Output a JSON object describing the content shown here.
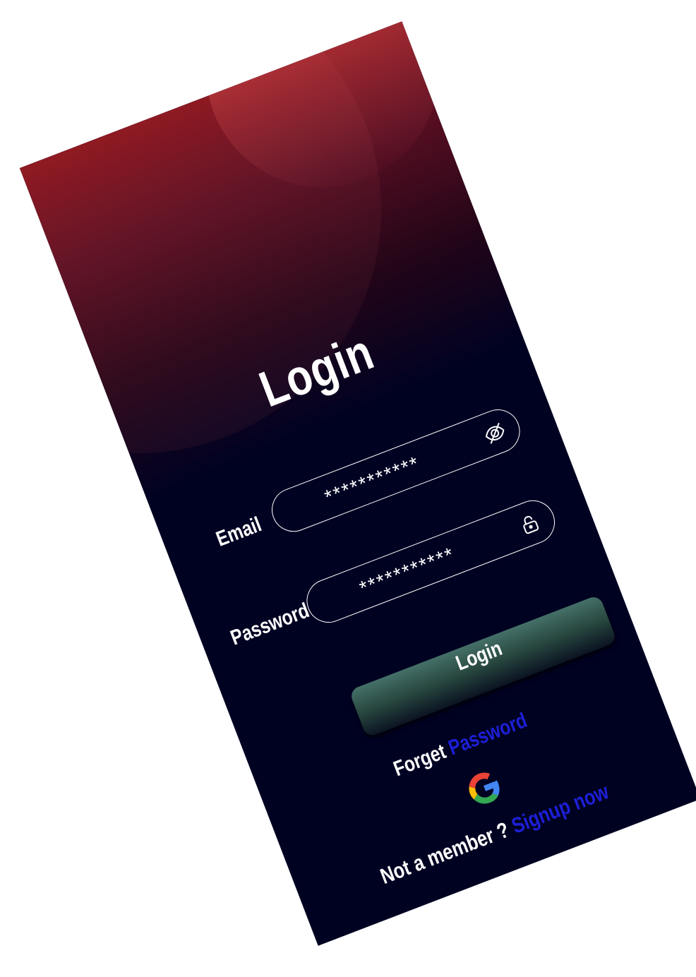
{
  "screen": {
    "title": "Login"
  },
  "form": {
    "email_label": "Email",
    "email_value": "***********",
    "password_label": "Password",
    "password_value": "***********",
    "email_icon": "eye-off-icon",
    "password_icon": "lock-icon"
  },
  "actions": {
    "login_label": "Login",
    "forgot_prefix": "Forget",
    "forgot_link": "Password",
    "google_icon": "google-icon",
    "signup_prefix": "Not a member ?",
    "signup_link": "Signup now"
  },
  "colors": {
    "background": "#000222",
    "gradient_top": "#8a151d",
    "link": "#1d1fd6",
    "button_top": "#447068"
  }
}
